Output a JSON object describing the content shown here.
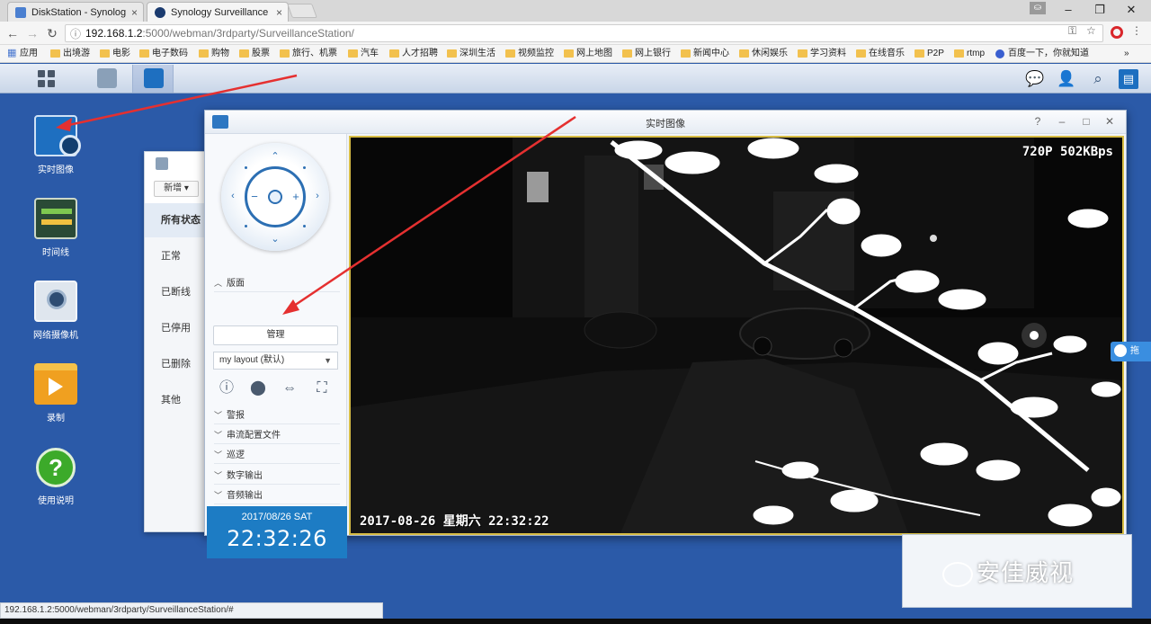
{
  "browser": {
    "tabs": [
      {
        "title": "DiskStation - Synolog",
        "active": false
      },
      {
        "title": "Synology Surveillance",
        "active": true
      }
    ],
    "url_host": "192.168.1.2",
    "url_path": ":5000/webman/3rdparty/SurveillanceStation/",
    "bookmarks": [
      "应用",
      "出境游",
      "电影",
      "电子数码",
      "购物",
      "股票",
      "旅行、机票",
      "汽车",
      "人才招聘",
      "深圳生活",
      "视频监控",
      "网上地图",
      "网上银行",
      "新闻中心",
      "休闲娱乐",
      "学习资料",
      "在线音乐",
      "P2P",
      "rtmp",
      "百度一下，你就知道"
    ],
    "bookmarks_more": "»",
    "status_url": "192.168.1.2:5000/webman/3rdparty/SurveillanceStation/#"
  },
  "desktop": {
    "icons": [
      {
        "label": "实时图像",
        "icon": "live-view-icon"
      },
      {
        "label": "时间线",
        "icon": "timeline-icon"
      },
      {
        "label": "网络摄像机",
        "icon": "ip-camera-icon"
      },
      {
        "label": "录制",
        "icon": "recording-icon"
      },
      {
        "label": "使用说明",
        "icon": "help-icon"
      }
    ]
  },
  "bg_window": {
    "new_button": "新增",
    "status_items": [
      "所有状态",
      "正常",
      "已断线",
      "已停用",
      "已删除",
      "其他"
    ]
  },
  "main_window": {
    "title": "实时图像",
    "layout_section": "版面",
    "manage_button": "管理",
    "layout_select": "my layout (默认)",
    "sections": [
      "警报",
      "串流配置文件",
      "巡逻",
      "数字输出",
      "音频输出"
    ],
    "clock_date": "2017/08/26  SAT",
    "clock_time": "22:32:26",
    "video": {
      "resolution_osd": "720P 502KBps",
      "timestamp_osd": "2017-08-26 星期六 22:32:22"
    }
  },
  "side_tab": "拖",
  "watermark": "安佳威视",
  "colors": {
    "desktop": "#2b5aa8",
    "accent": "#1d7cc4",
    "video_border": "#d7bd45",
    "arrow": "#e53030"
  }
}
